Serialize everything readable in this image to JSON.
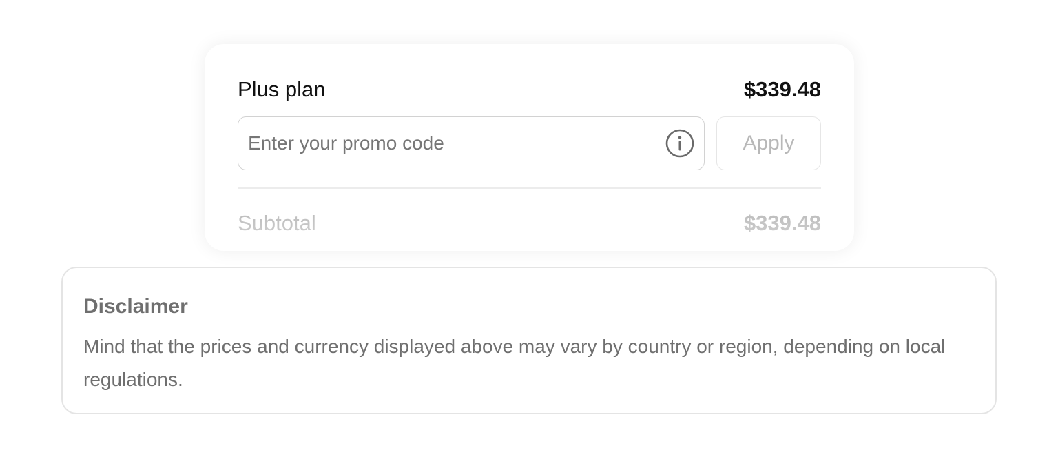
{
  "order": {
    "plan_name": "Plus plan",
    "plan_price": "$339.48",
    "promo": {
      "placeholder": "Enter your promo code",
      "value": "",
      "info_icon": "info-circle-icon",
      "apply_label": "Apply"
    },
    "subtotal_label": "Subtotal",
    "subtotal_value": "$339.48"
  },
  "disclaimer": {
    "title": "Disclaimer",
    "text": "Mind that the prices and currency displayed above may vary by country or region, depending on local regulations."
  },
  "colors": {
    "text_primary": "#111111",
    "text_muted": "#6f6f6f",
    "text_disabled": "#b8b8b8",
    "border": "#d2d2d2"
  }
}
